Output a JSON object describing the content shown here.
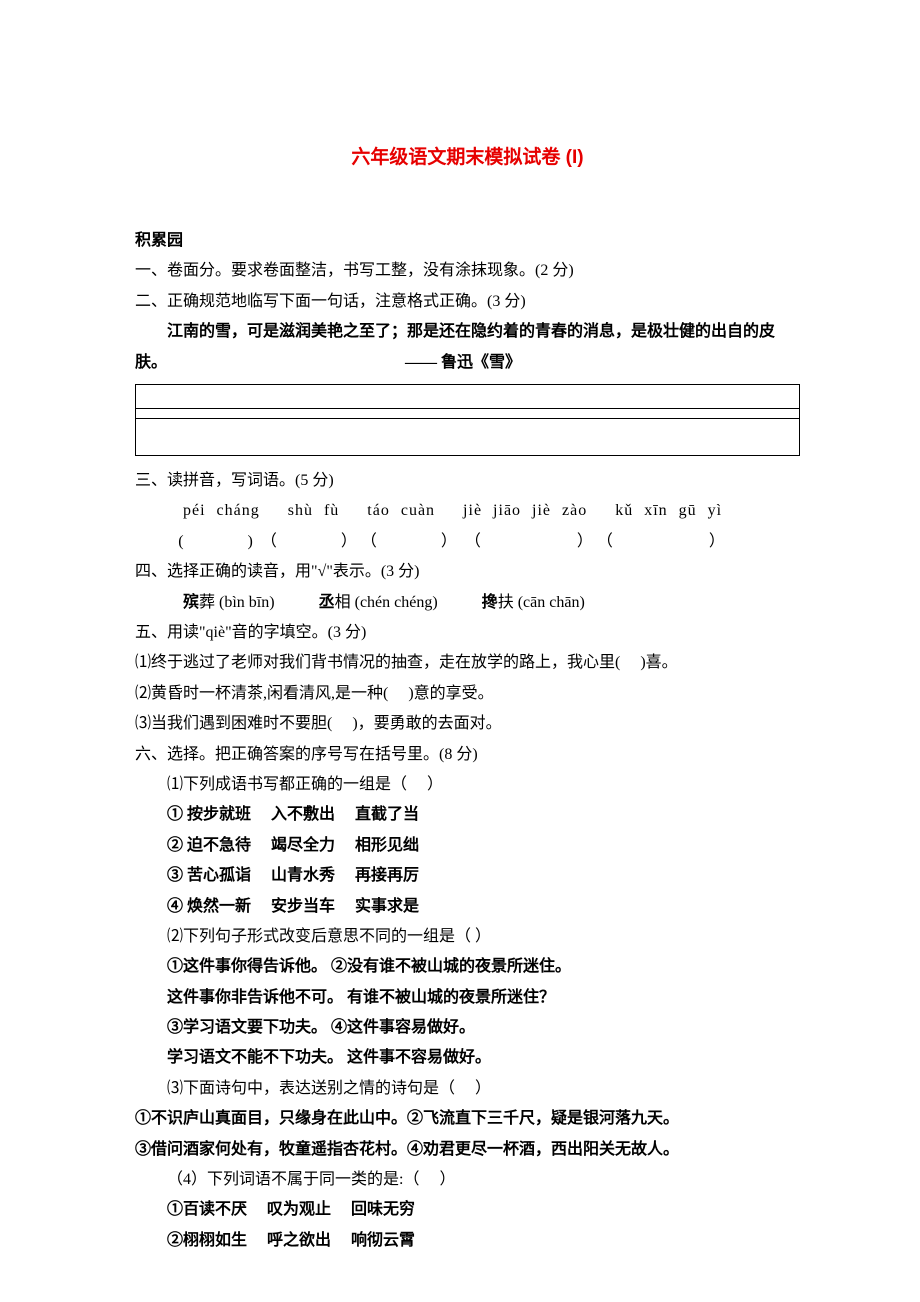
{
  "title": "六年级语文期末模拟试卷 (I)",
  "section_label": "积累园",
  "q1": "一、卷面分。要求卷面整洁，书写工整，没有涂抹现象。(2 分)",
  "q2": "二、正确规范地临写下面一句话，注意格式正确。(3 分)",
  "quote": "江南的雪，可是滋润美艳之至了；那是还在隐约着的青春的消息，是极壮健的出自的皮",
  "quote_tail": "肤。",
  "attribution": "—— 鲁迅《雪》",
  "q3": "三、读拼音，写词语。(5 分)",
  "pinyin": "péi cháng   shù  fù   táo  cuàn    jiè jiāo jiè zào   kǔ  xīn  gū  yì",
  "q4": "四、选择正确的读音，用\"√\"表示。(3 分)",
  "phon": {
    "a_char": "殡",
    "a_word": "葬",
    "a_py": "(bìn  bīn)",
    "b_char": "丞",
    "b_word": "相",
    "b_py": "(chén  chéng)",
    "c_char": "搀",
    "c_word": "扶",
    "c_py": "(cān  chān)"
  },
  "q5": "五、用读\"qiè\"音的字填空。(3 分)",
  "q5_1": "⑴终于逃过了老师对我们背书情况的抽查，走在放学的路上，我心里(   )喜。",
  "q5_2": "⑵黄昏时一杯清茶,闲看清风,是一种(   )意的享受。",
  "q5_3": "⑶当我们遇到困难时不要胆(   )，要勇敢的去面对。",
  "q6": "六、选择。把正确答案的序号写在括号里。(8 分)",
  "q6_1": "⑴下列成语书写都正确的一组是（    ）",
  "q6_1a": "① 按步就班    入不敷出   直截了当",
  "q6_1b": "② 迫不急待    竭尽全力   相形见绌",
  "q6_1c": "③ 苦心孤诣    山青水秀   再接再厉",
  "q6_1d": "④ 焕然一新    安步当车   实事求是",
  "q6_2": "⑵下列句子形式改变后意思不同的一组是（ ）",
  "q6_2a": "①这件事你得告诉他。  ②没有谁不被山城的夜景所迷住。",
  "q6_2b": "这件事你非告诉他不可。   有谁不被山城的夜景所迷住？",
  "q6_2c": "③学习语文要下功夫。  ④这件事容易做好。",
  "q6_2d": "学习语文不能不下功夫。  这件事不容易做好。",
  "q6_3": "⑶下面诗句中，表达送别之情的诗句是（      ）",
  "q6_3a": "①不识庐山真面目，只缘身在此山中。②飞流直下三千尺，疑是银河落九天。",
  "q6_3b": "③借问酒家何处有，牧童遥指杏花村。④劝君更尽一杯酒，西出阳关无故人。",
  "q6_4": "（4）下列词语不属于同一类的是:（      ）",
  "q6_4a": "①百读不厌   叹为观止   回味无穷",
  "q6_4b": "②栩栩如生   呼之欲出   响彻云霄"
}
